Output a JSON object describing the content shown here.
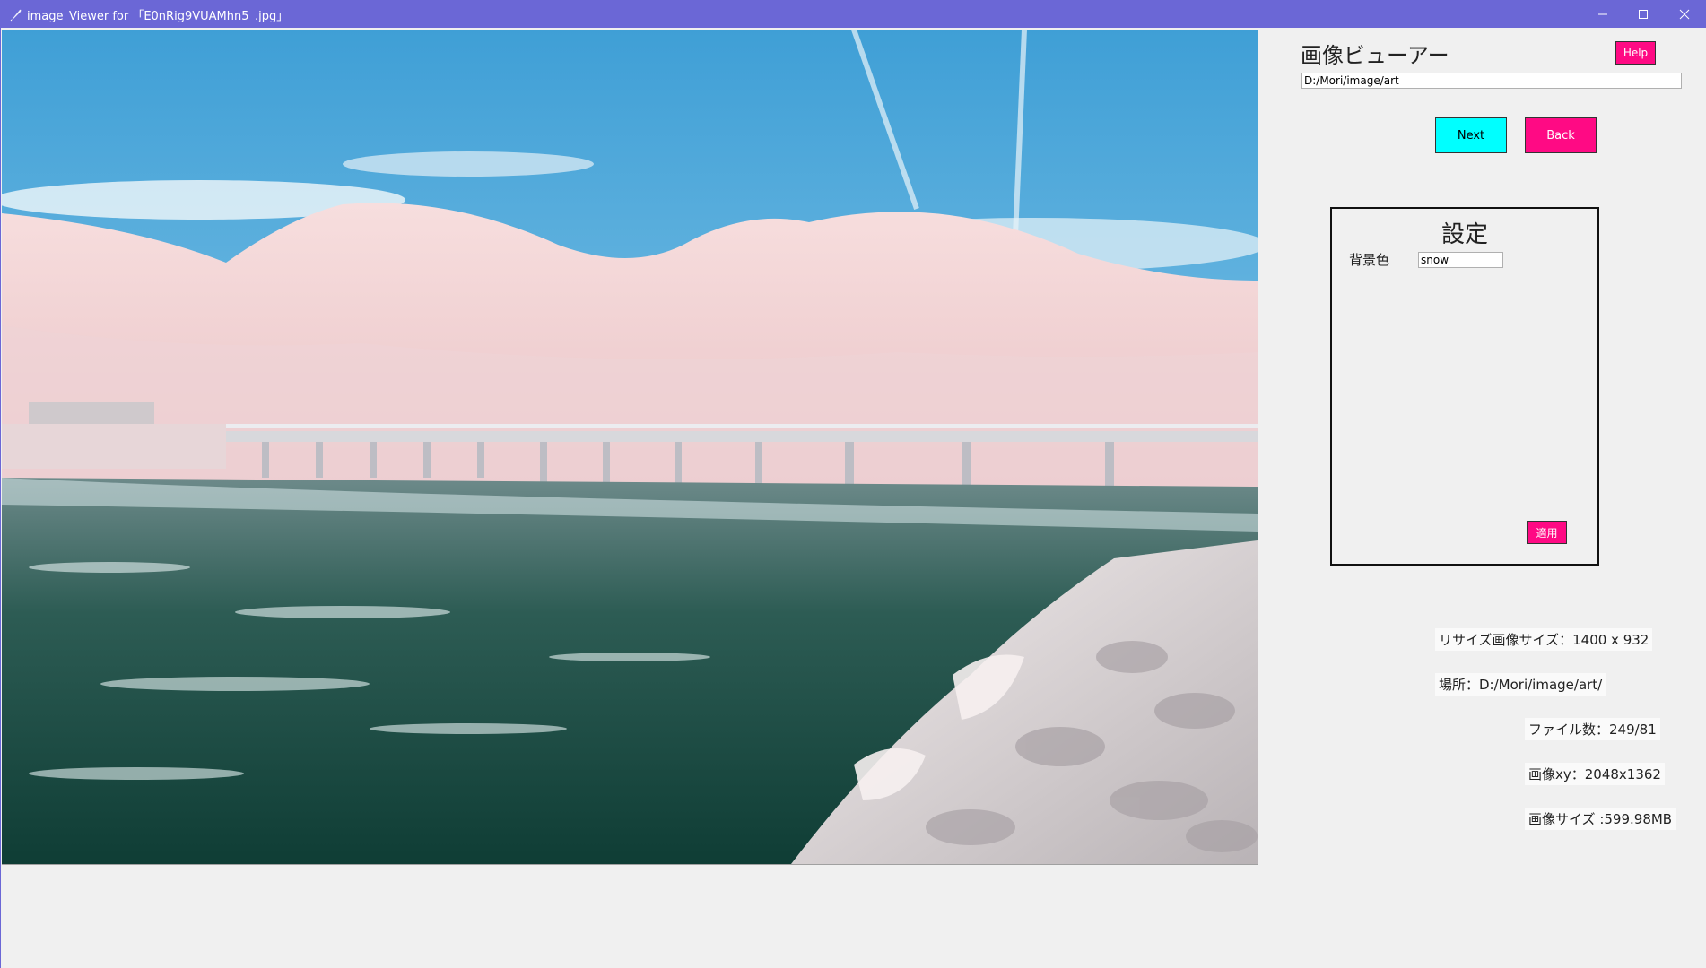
{
  "window": {
    "title": "image_Viewer for 「E0nRig9VUAMhn5_.jpg」",
    "controls": {
      "minimize": "─",
      "maximize": "☐",
      "close": "✕"
    }
  },
  "header": {
    "app_title": "画像ビューアー",
    "help_label": "Help",
    "path_value": "D:/Mori/image/art"
  },
  "nav": {
    "next_label": "Next",
    "back_label": "Back"
  },
  "settings": {
    "title": "設定",
    "background_color_label": "背景色",
    "background_color_value": "snow",
    "apply_label": "適用"
  },
  "info": {
    "resize_size": "リサイズ画像サイズ：1400 x 932",
    "location": "場所：D:/Mori/image/art/",
    "file_count": "ファイル数：249/81",
    "image_xy": "画像xy：2048x1362",
    "image_size": "画像サイズ :599.98MB"
  },
  "colors": {
    "titlebar": "#6b67d6",
    "accent_pink": "#ff0a84",
    "accent_cyan": "#00ffff",
    "background": "#f0f0f0"
  },
  "icons": {
    "app": "feather-icon",
    "minimize": "minimize-icon",
    "maximize": "maximize-icon",
    "close": "close-icon"
  }
}
